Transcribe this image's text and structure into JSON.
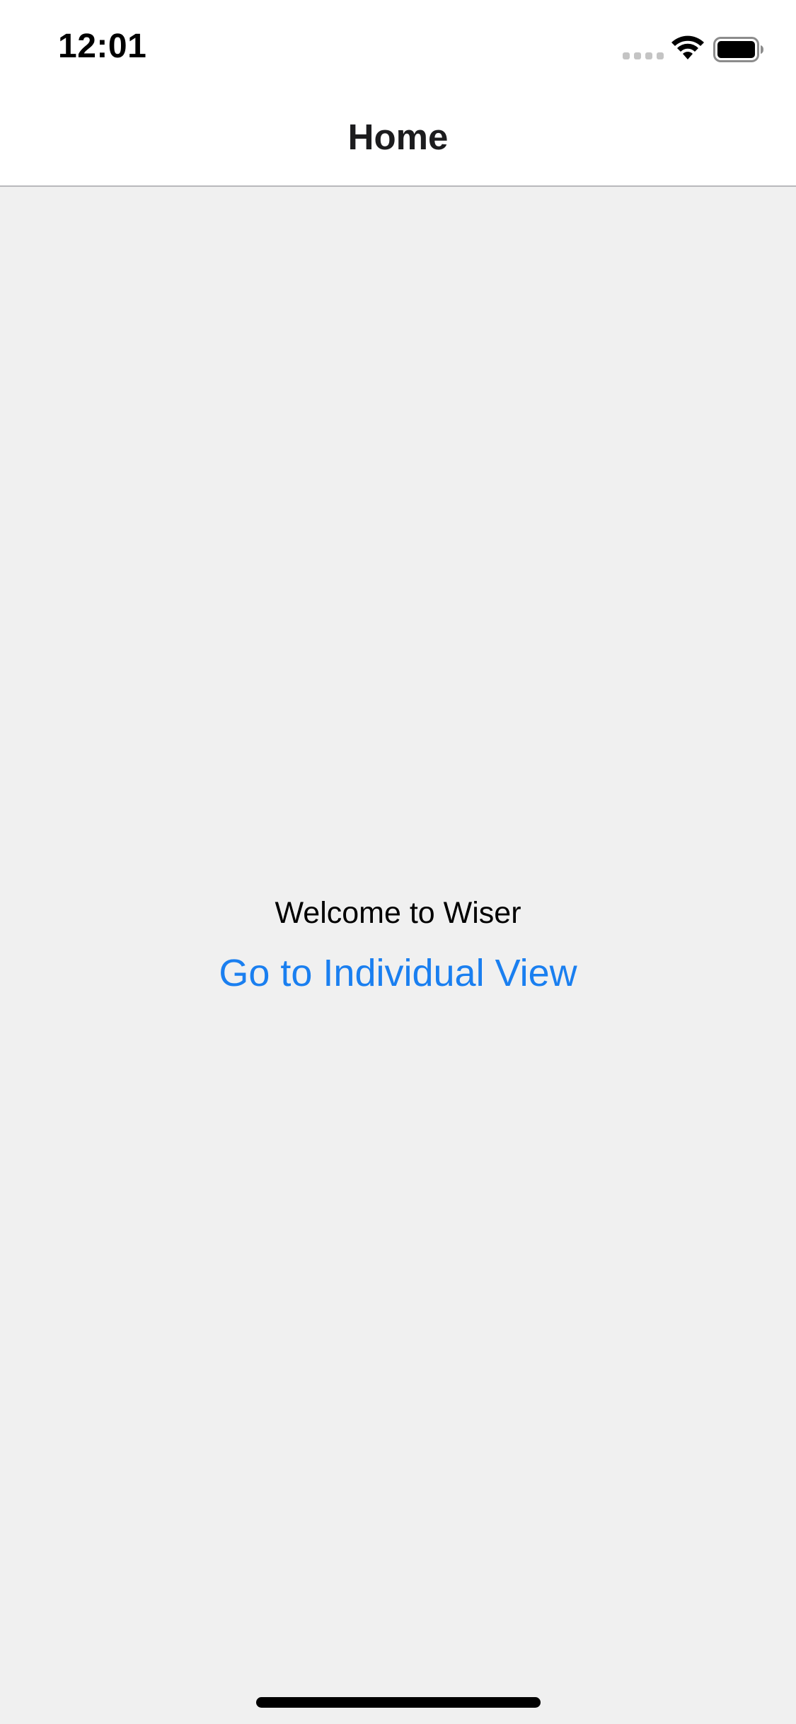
{
  "status_bar": {
    "time": "12:01",
    "signal_icon": "cellular-signal-icon",
    "wifi_icon": "wifi-icon",
    "battery_icon": "battery-icon"
  },
  "nav_bar": {
    "title": "Home"
  },
  "main": {
    "welcome_text": "Welcome to Wiser",
    "link_label": "Go to Individual View"
  },
  "colors": {
    "link": "#1a7ff0",
    "background": "#f0f0f0",
    "nav_background": "#ffffff"
  }
}
